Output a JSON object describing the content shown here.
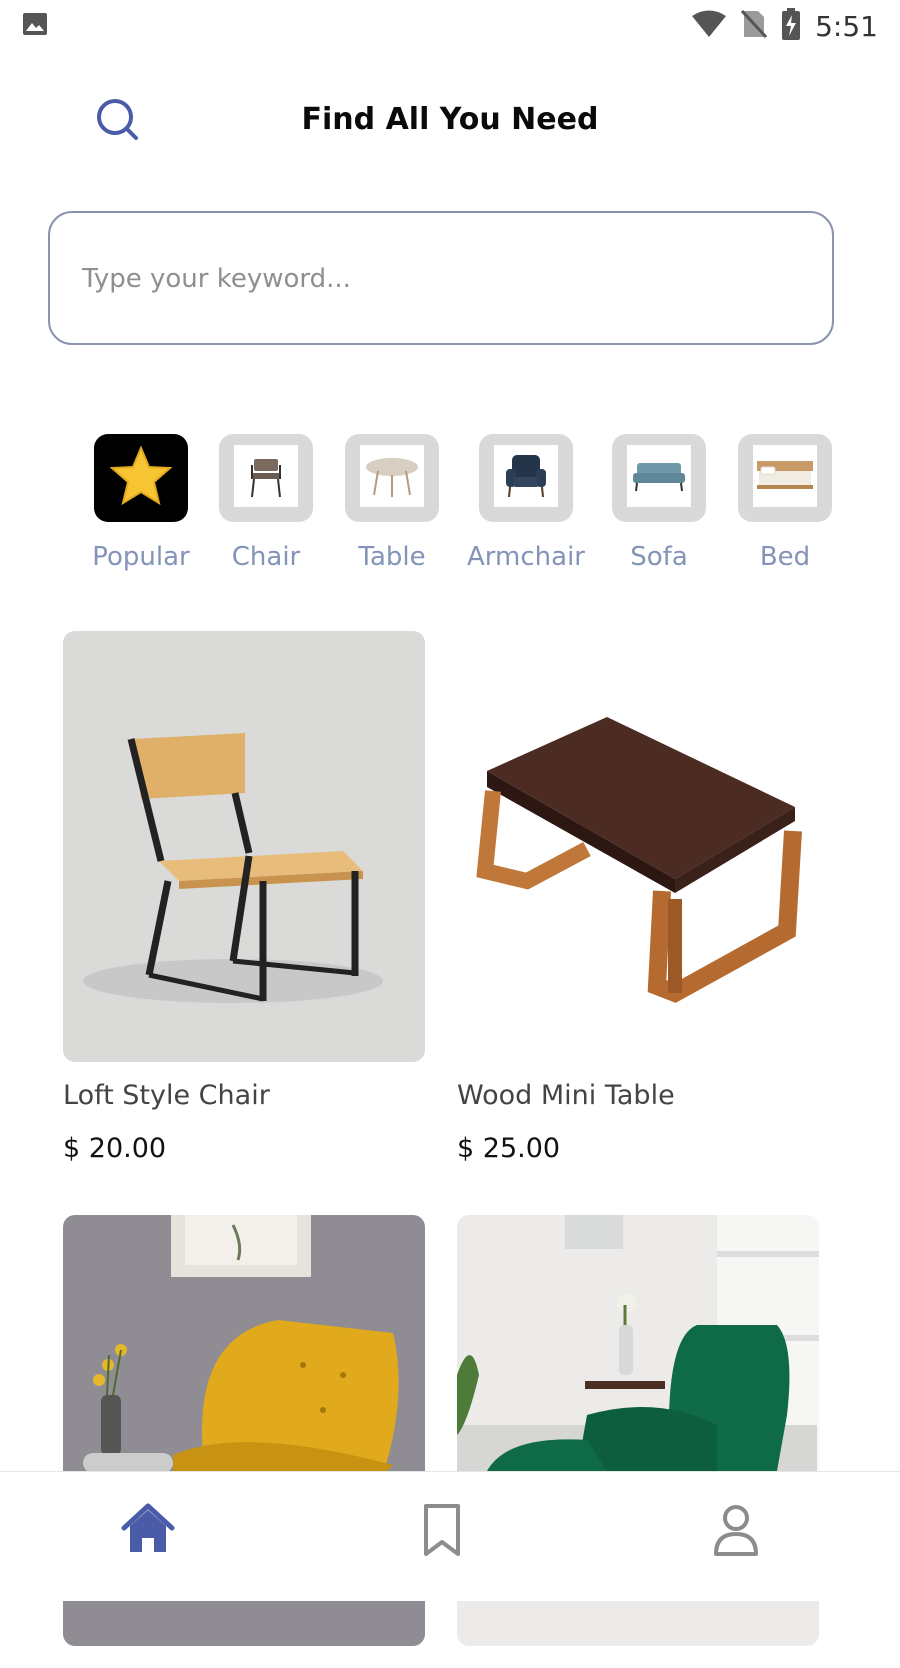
{
  "status_bar": {
    "time": "5:51",
    "icons": [
      "image-notification-icon",
      "wifi-icon",
      "no-sim-icon",
      "battery-charging-icon"
    ]
  },
  "header": {
    "title": "Find All You Need",
    "search_icon": "search-icon"
  },
  "search": {
    "placeholder": "Type your keyword...",
    "value": ""
  },
  "categories": [
    {
      "label": "Popular",
      "icon": "star-icon",
      "active": true
    },
    {
      "label": "Chair",
      "icon": "chair-thumbnail"
    },
    {
      "label": "Table",
      "icon": "table-thumbnail"
    },
    {
      "label": "Armchair",
      "icon": "armchair-thumbnail"
    },
    {
      "label": "Sofa",
      "icon": "sofa-thumbnail"
    },
    {
      "label": "Bed",
      "icon": "bed-thumbnail"
    }
  ],
  "products": [
    {
      "name": "Loft Style Chair",
      "price": "$ 20.00"
    },
    {
      "name": "Wood Mini Table",
      "price": "$ 25.00"
    },
    {
      "name": "",
      "price": ""
    },
    {
      "name": "",
      "price": ""
    }
  ],
  "bottom_nav": {
    "items": [
      "home-icon",
      "bookmark-icon",
      "profile-icon"
    ],
    "active": "home-icon"
  },
  "colors": {
    "accent": "#4a5ba8",
    "category_label": "#8494b8",
    "search_border": "#8a94b0",
    "inactive_icon": "#8c8c8c"
  }
}
